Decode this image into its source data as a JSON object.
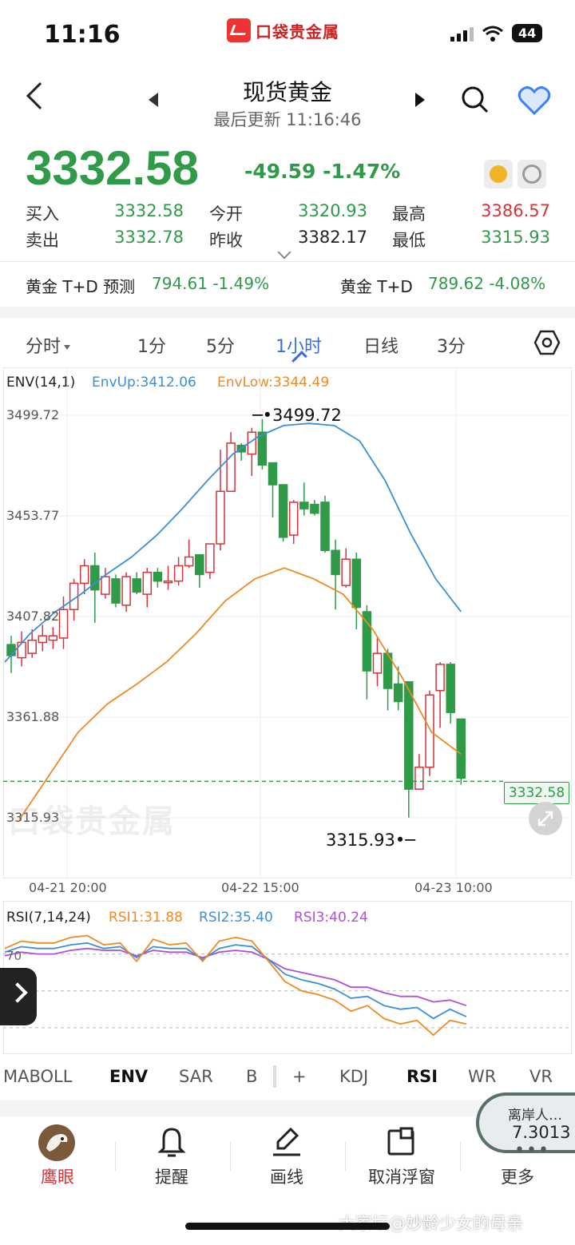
{
  "status_bar": {
    "time": "11:16",
    "app_logo": "口袋贵金属",
    "battery": "44"
  },
  "nav": {
    "title": "现货黄金",
    "subtitle": "最后更新 11:16:46"
  },
  "quote": {
    "price": "3332.58",
    "change": "-49.59 -1.47%",
    "buy_label": "买入",
    "buy": "3332.58",
    "sell_label": "卖出",
    "sell": "3332.78",
    "open_label": "今开",
    "open": "3320.93",
    "prev_label": "昨收",
    "prev": "3382.17",
    "high_label": "最高",
    "high": "3386.57",
    "low_label": "最低",
    "low": "3315.93"
  },
  "related": [
    {
      "name": "黄金 T+D 预测",
      "value": "794.61 -1.49%"
    },
    {
      "name": "黄金 T+D",
      "value": "789.62 -4.08%"
    }
  ],
  "tabs": {
    "intraday": "分时",
    "m1": "1分",
    "m5": "5分",
    "h1": "1小时",
    "daily": "日线",
    "m3": "3分"
  },
  "env": {
    "name": "ENV(14,1)",
    "up": "EnvUp:3412.06",
    "low": "EnvLow:3344.49"
  },
  "price_axis": [
    "3499.72",
    "3453.77",
    "3407.82",
    "3361.88",
    "3315.93"
  ],
  "annotations": {
    "high": "3499.72",
    "low": "3315.93",
    "current": "3332.58"
  },
  "time_axis": [
    "04-21 20:00",
    "04-22 15:00",
    "04-23 10:00"
  ],
  "rsi": {
    "name": "RSI(7,14,24)",
    "r1": "RSI1:31.88",
    "r2": "RSI2:35.40",
    "r3": "RSI3:40.24",
    "level": "70"
  },
  "indicators": {
    "maboll": "MABOLL",
    "env": "ENV",
    "sar": "SAR",
    "b": "B",
    "plus": "+",
    "kdj": "KDJ",
    "rsi": "RSI",
    "wr": "WR",
    "vr": "VR"
  },
  "fx": {
    "name": "离岸人…",
    "value": "7.3013"
  },
  "bottom_nav": {
    "eagle": "鹰眼",
    "alert": "提醒",
    "draw": "画线",
    "cancel_float": "取消浮窗",
    "more": "更多"
  },
  "watermark": "大家坛@妙龄少女的母亲",
  "chart_watermark": "口袋贵金属",
  "colors": {
    "up": "#d6333a",
    "down": "#2f9a48",
    "env_up": "#3a8fd6",
    "env_low": "#ef8a22",
    "rsi3": "#b04fd8",
    "accent": "#3b6fd8"
  },
  "chart_data": {
    "type": "candlestick",
    "ylim": [
      3315.93,
      3499.72
    ],
    "candles": [
      [
        3395,
        3390,
        3399,
        3382
      ],
      [
        3389,
        3396,
        3401,
        3385
      ],
      [
        3391,
        3397,
        3402,
        3389
      ],
      [
        3396,
        3399,
        3404,
        3392
      ],
      [
        3397,
        3399,
        3403,
        3393
      ],
      [
        3398,
        3411,
        3417,
        3393
      ],
      [
        3411,
        3423,
        3425,
        3406
      ],
      [
        3423,
        3431,
        3434,
        3418
      ],
      [
        3431,
        3420,
        3437,
        3405
      ],
      [
        3418,
        3426,
        3430,
        3416
      ],
      [
        3425,
        3414,
        3427,
        3412
      ],
      [
        3413,
        3426,
        3428,
        3410
      ],
      [
        3425,
        3419,
        3428,
        3418
      ],
      [
        3418,
        3428,
        3430,
        3412
      ],
      [
        3428,
        3424,
        3430,
        3421
      ],
      [
        3424,
        3424,
        3431,
        3420
      ],
      [
        3424,
        3431,
        3435,
        3422
      ],
      [
        3431,
        3435,
        3443,
        3430
      ],
      [
        3436,
        3427,
        3436,
        3421
      ],
      [
        3428,
        3441,
        3441,
        3425
      ],
      [
        3441,
        3465,
        3484,
        3438
      ],
      [
        3465,
        3487,
        3492,
        3465
      ],
      [
        3486,
        3483,
        3487,
        3479
      ],
      [
        3482,
        3492,
        3494,
        3472
      ],
      [
        3492,
        3477,
        3498,
        3475
      ],
      [
        3478,
        3468,
        3478,
        3453
      ],
      [
        3468,
        3444,
        3468,
        3442
      ],
      [
        3445,
        3460,
        3461,
        3441
      ],
      [
        3460,
        3457,
        3469,
        3454
      ],
      [
        3459,
        3455,
        3461,
        3454
      ],
      [
        3460,
        3438,
        3463,
        3437
      ],
      [
        3438,
        3427,
        3443,
        3411
      ],
      [
        3422,
        3434,
        3439,
        3421
      ],
      [
        3434,
        3412,
        3437,
        3402
      ],
      [
        3410,
        3383,
        3413,
        3370
      ],
      [
        3382,
        3391,
        3398,
        3376
      ],
      [
        3391,
        3375,
        3393,
        3365
      ],
      [
        3377,
        3369,
        3385,
        3365
      ],
      [
        3378,
        3329,
        3378,
        3316
      ],
      [
        3329,
        3339,
        3345,
        3337
      ],
      [
        3339,
        3372,
        3374,
        3335
      ],
      [
        3374,
        3386,
        3387,
        3357
      ],
      [
        3386,
        3364,
        3387,
        3359
      ],
      [
        3361,
        3334,
        3361,
        3331
      ]
    ],
    "env_up": [
      3387,
      3400,
      3410,
      3418,
      3427,
      3435,
      3445,
      3457,
      3470,
      3482,
      3490,
      3495,
      3496,
      3495,
      3488,
      3470,
      3446,
      3425,
      3410
    ],
    "env_low": [
      3315,
      3335,
      3355,
      3368,
      3377,
      3387,
      3400,
      3415,
      3425,
      3430,
      3425,
      3418,
      3402,
      3380,
      3355,
      3345
    ],
    "rsi1": [
      73,
      77,
      76,
      76,
      79,
      80,
      75,
      76,
      66,
      78,
      75,
      76,
      66,
      77,
      79,
      77,
      66,
      55,
      50,
      48,
      45,
      39,
      42,
      35,
      32,
      34,
      26,
      34,
      32
    ],
    "rsi2": [
      71,
      74,
      73,
      73,
      75,
      76,
      73,
      74,
      68,
      74,
      73,
      73,
      67,
      73,
      75,
      74,
      67,
      59,
      56,
      54,
      51,
      46,
      47,
      42,
      40,
      41,
      35,
      40,
      36
    ],
    "rsi3": [
      69,
      71,
      70,
      70,
      72,
      73,
      72,
      72,
      69,
      72,
      71,
      71,
      68,
      71,
      72,
      71,
      67,
      62,
      60,
      58,
      56,
      52,
      52,
      49,
      47,
      47,
      44,
      45,
      42
    ]
  }
}
